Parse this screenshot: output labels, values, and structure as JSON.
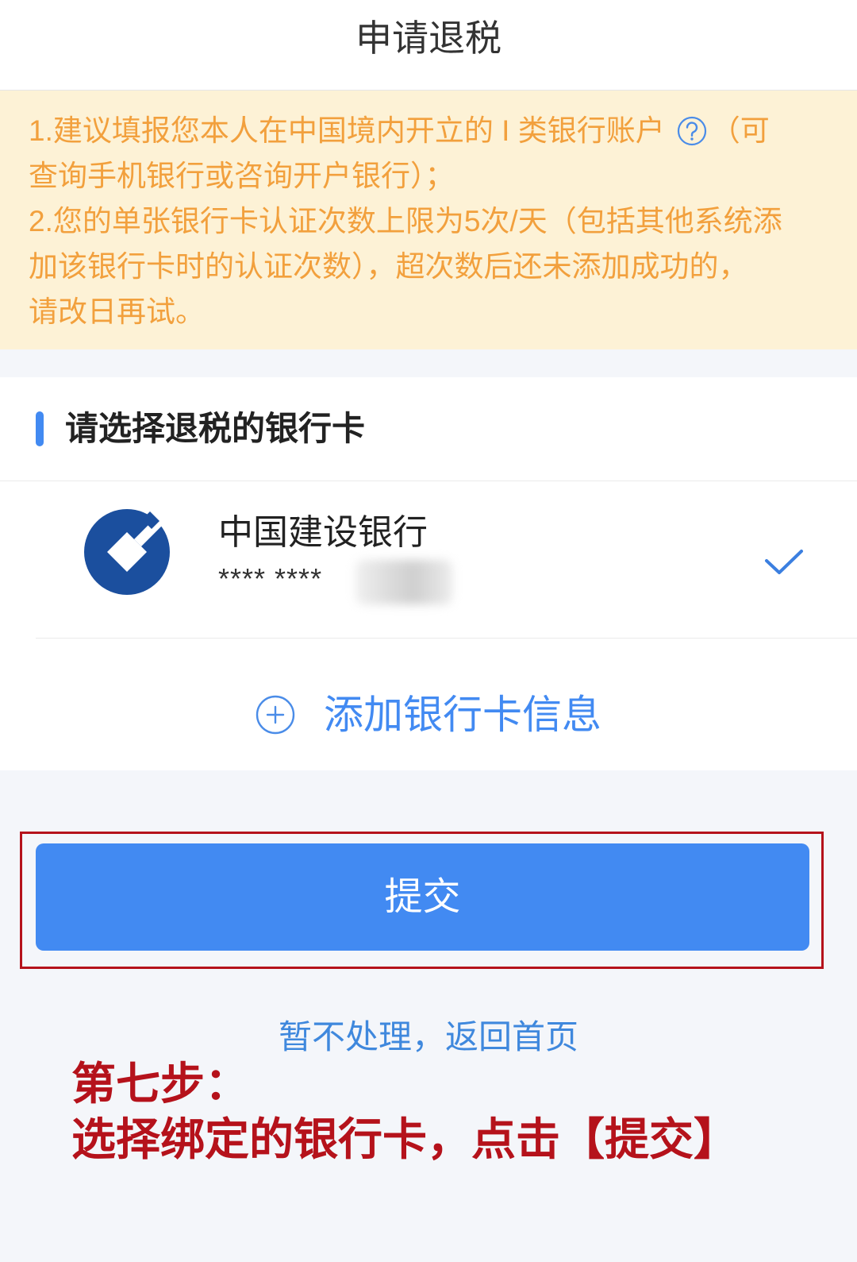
{
  "header": {
    "title": "申请退税"
  },
  "notice": {
    "item1": {
      "line1_text": "1.建议填报您本人在中国境内开立的 I 类银行账户",
      "line1_tail": "（可",
      "line2": "查询手机银行或咨询开户银行）；"
    },
    "item2": {
      "lines": [
        "2.您的单张银行卡认证次数上限为5次/天（包括其他系统添",
        "加该银行卡时的认证次数），超次数后还未添加成功的，",
        "请改日再试。"
      ]
    },
    "help_icon": "question-circle-icon"
  },
  "card_section": {
    "title": "请选择退税的银行卡",
    "cards": [
      {
        "bank_name": "中国建设银行",
        "card_number_masked": "**** ****",
        "selected": true,
        "logo": "ccb-logo",
        "selected_icon": "checkmark-icon"
      }
    ],
    "add_card_label": "添加银行卡信息",
    "add_card_icon": "plus-circle-icon"
  },
  "actions": {
    "submit_label": "提交",
    "skip_link": "暂不处理，返回首页"
  },
  "annotation": {
    "step": "第七步：",
    "instruction": "选择绑定的银行卡，点击【提交】"
  },
  "colors": {
    "accent": "#428AF2",
    "link": "#3F88DD",
    "notice_bg": "#FDF2D6",
    "notice_text": "#F2A03D",
    "page_bg": "#F4F6FA",
    "annotation": "#B5121B",
    "ccb_blue": "#1B4F9E"
  }
}
